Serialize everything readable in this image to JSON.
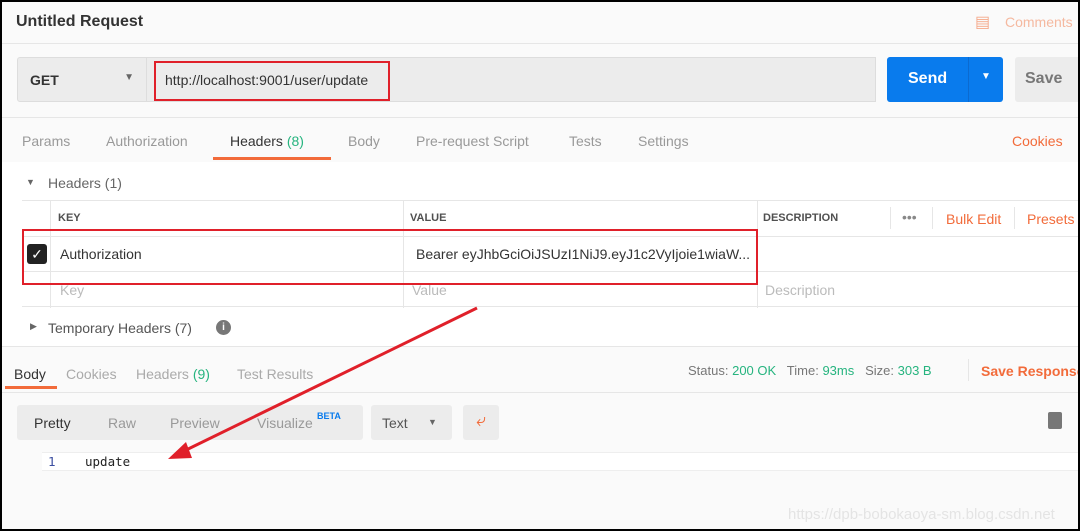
{
  "request": {
    "title": "Untitled Request",
    "comments_label": "Comments",
    "method": "GET",
    "url": "http://localhost:9001/user/update",
    "send_label": "Send",
    "save_label": "Save"
  },
  "request_tabs": [
    {
      "label": "Params"
    },
    {
      "label": "Authorization"
    },
    {
      "label": "Headers",
      "count": "(8)"
    },
    {
      "label": "Body"
    },
    {
      "label": "Pre-request Script"
    },
    {
      "label": "Tests"
    },
    {
      "label": "Settings"
    }
  ],
  "cookies_label": "Cookies",
  "headers_section": {
    "title": "Headers (1)",
    "columns": {
      "key": "KEY",
      "value": "VALUE",
      "description": "DESCRIPTION"
    },
    "more": "•••",
    "bulk_edit": "Bulk Edit",
    "presets": "Presets",
    "rows": [
      {
        "key": "Authorization",
        "value": "Bearer eyJhbGciOiJSUzI1NiJ9.eyJ1c2VyIjoie1wiaW...",
        "description": ""
      }
    ],
    "placeholders": {
      "key": "Key",
      "value": "Value",
      "description": "Description"
    },
    "temporary": "Temporary Headers (7)"
  },
  "response": {
    "tabs": [
      {
        "label": "Body"
      },
      {
        "label": "Cookies"
      },
      {
        "label": "Headers",
        "count": "(9)"
      },
      {
        "label": "Test Results"
      }
    ],
    "status_label": "Status:",
    "status": "200 OK",
    "time_label": "Time:",
    "time": "93ms",
    "size_label": "Size:",
    "size": "303 B",
    "save_response": "Save Response",
    "views": [
      "Pretty",
      "Raw",
      "Preview",
      "Visualize"
    ],
    "beta": "BETA",
    "format": "Text",
    "lines": [
      {
        "n": "1",
        "text": "update"
      }
    ]
  },
  "watermark": "https://dpb-bobokaoya-sm.blog.csdn.net"
}
